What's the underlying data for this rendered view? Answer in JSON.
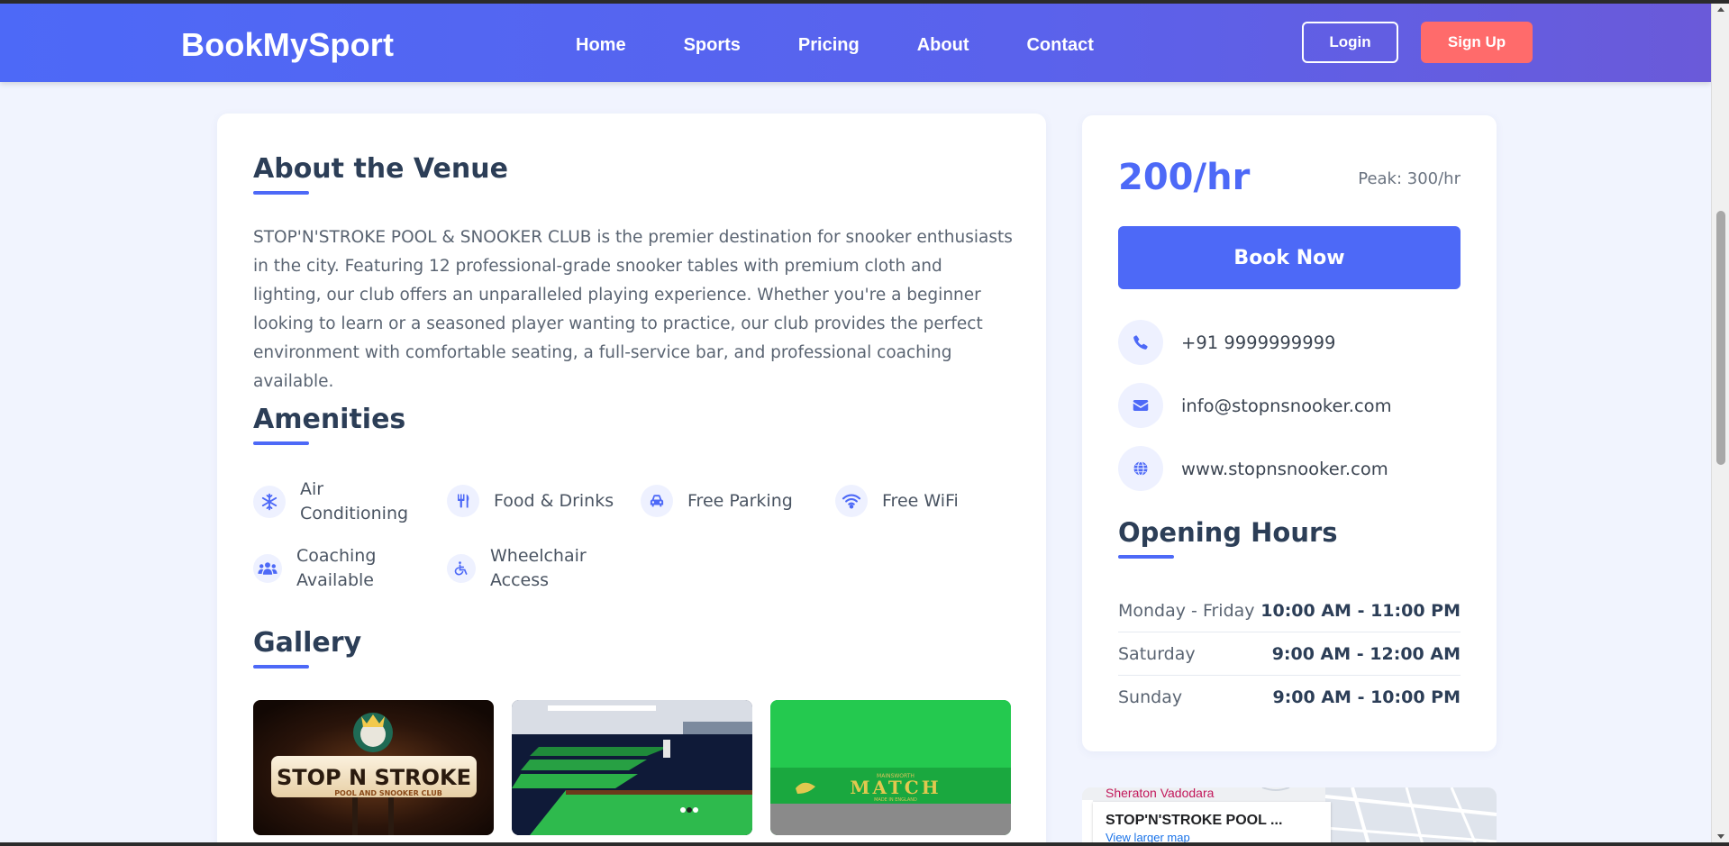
{
  "navbar": {
    "brand": "BookMySport",
    "links": [
      "Home",
      "Sports",
      "Pricing",
      "About",
      "Contact"
    ],
    "login_label": "Login",
    "signup_label": "Sign Up"
  },
  "about": {
    "title": "About the Venue",
    "text": "STOP'N'STROKE POOL & SNOOKER CLUB is the premier destination for snooker enthusiasts in the city. Featuring 12 professional-grade snooker tables with premium cloth and lighting, our club offers an unparalleled playing experience. Whether you're a beginner looking to learn or a seasoned player wanting to practice, our club provides the perfect environment with comfortable seating, a full-service bar, and professional coaching available."
  },
  "amenities": {
    "title": "Amenities",
    "items": [
      {
        "label": "Air Conditioning",
        "icon": "snowflake-icon"
      },
      {
        "label": "Food & Drinks",
        "icon": "utensils-icon"
      },
      {
        "label": "Free Parking",
        "icon": "car-icon"
      },
      {
        "label": "Free WiFi",
        "icon": "wifi-icon"
      },
      {
        "label": "Coaching Available",
        "icon": "users-icon"
      },
      {
        "label": "Wheelchair Access",
        "icon": "wheelchair-icon"
      }
    ]
  },
  "gallery": {
    "title": "Gallery",
    "images": [
      {
        "sign_line1": "STOP N STROKE",
        "sign_line2": "POOL AND SNOOKER CLUB"
      },
      {},
      {
        "brand_small": "MAINSWORTH",
        "brand_large": "MATCH",
        "brand_sub": "MADE IN ENGLAND"
      }
    ]
  },
  "booking": {
    "price": "200/hr",
    "peak": "Peak: 300/hr",
    "book_label": "Book Now",
    "phone": "+91 9999999999",
    "email": "info@stopnsnooker.com",
    "website": "www.stopnsnooker.com"
  },
  "hours": {
    "title": "Opening Hours",
    "rows": [
      {
        "day": "Monday - Friday",
        "time": "10:00 AM - 11:00 PM"
      },
      {
        "day": "Saturday",
        "time": "9:00 AM - 12:00 AM"
      },
      {
        "day": "Sunday",
        "time": "9:00 AM - 10:00 PM"
      }
    ]
  },
  "map": {
    "place": "Sheraton Vadodara",
    "title": "STOP'N'STROKE POOL ...",
    "link": "View larger map"
  },
  "colors": {
    "primary": "#4d69f7",
    "accent": "#ff6b6b",
    "heading": "#2c3e57"
  }
}
